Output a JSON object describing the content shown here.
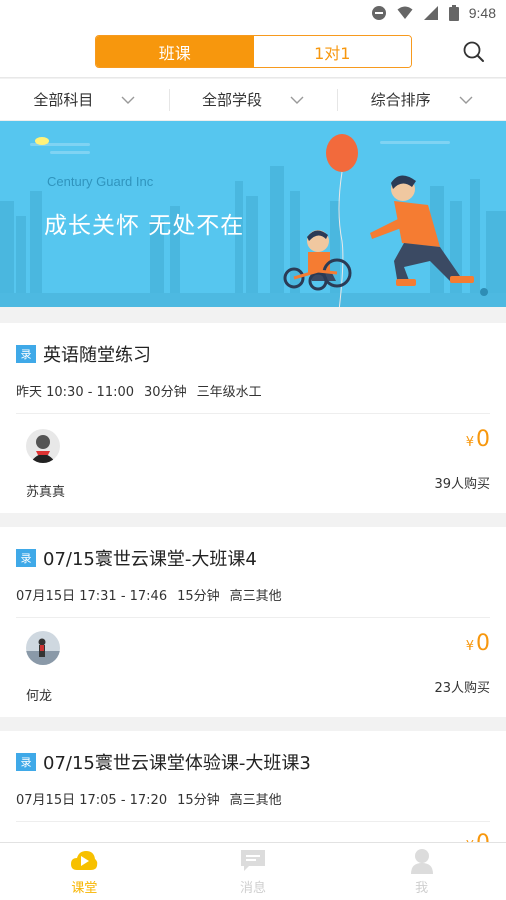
{
  "status_bar": {
    "time": "9:48"
  },
  "header": {
    "tabs": [
      {
        "label": "班课",
        "active": true
      },
      {
        "label": "1对1",
        "active": false
      }
    ],
    "search_icon": "search-icon"
  },
  "filters": [
    {
      "label": "全部科目"
    },
    {
      "label": "全部学段"
    },
    {
      "label": "综合排序"
    }
  ],
  "banner": {
    "company": "Century Guard Inc",
    "slogan": "成长关怀   无处不在"
  },
  "courses": [
    {
      "badge": "录",
      "title": "英语随堂练习",
      "time": "昨天 10:30 - 11:00",
      "duration": "30分钟",
      "grade": "三年级水工",
      "teacher": "苏真真",
      "currency": "¥",
      "price": "0",
      "buyers": "39人购买"
    },
    {
      "badge": "录",
      "title": "07/15寰世云课堂-大班课4",
      "time": "07月15日 17:31 - 17:46",
      "duration": "15分钟",
      "grade": "高三其他",
      "teacher": "何龙",
      "currency": "¥",
      "price": "0",
      "buyers": "23人购买"
    },
    {
      "badge": "录",
      "title": "07/15寰世云课堂体验课-大班课3",
      "time": "07月15日 17:05 - 17:20",
      "duration": "15分钟",
      "grade": "高三其他",
      "teacher": "",
      "currency": "¥",
      "price": "0",
      "buyers": ""
    }
  ],
  "bottom_nav": [
    {
      "label": "课堂",
      "icon": "play-cloud-icon",
      "active": true
    },
    {
      "label": "消息",
      "icon": "message-icon",
      "active": false
    },
    {
      "label": "我",
      "icon": "user-icon",
      "active": false
    }
  ],
  "colors": {
    "accent": "#f7970d",
    "banner_bg": "#56c6ef",
    "badge": "#3fa9e8",
    "nav_active": "#f7b500"
  }
}
